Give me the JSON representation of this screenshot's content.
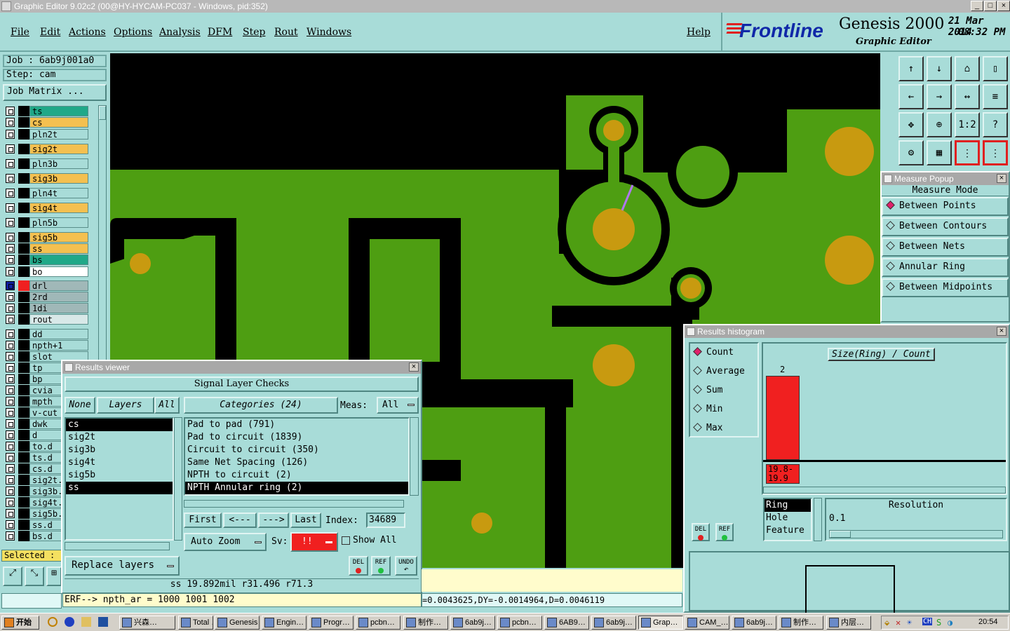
{
  "window": {
    "title": "Graphic Editor 9.02c2 (00@HY-HYCAM-PC037 - Windows, pid:352)"
  },
  "menu": {
    "items": [
      "File",
      "Edit",
      "Actions",
      "Options",
      "Analysis",
      "DFM",
      "Step",
      "Rout",
      "Windows"
    ],
    "help": "Help"
  },
  "brand": {
    "logo": "Frontline",
    "product": "Genesis 2000",
    "subtitle": "Graphic Editor",
    "date": "21 Mar 2014",
    "time": "08:32 PM"
  },
  "job": {
    "job_label": "Job  : 6ab9j001a0",
    "step_label": "Step: cam",
    "matrix_button": "Job Matrix ..."
  },
  "layers": [
    {
      "name": "ts",
      "color": "#20a888"
    },
    {
      "name": "cs",
      "color": "#f4c050"
    },
    {
      "name": "pln2t",
      "color": "#a8dcd8"
    },
    {
      "name": "sig2t",
      "color": "#f4c050"
    },
    {
      "name": "pln3b",
      "color": "#a8dcd8"
    },
    {
      "name": "sig3b",
      "color": "#f4c050"
    },
    {
      "name": "pln4t",
      "color": "#a8dcd8"
    },
    {
      "name": "sig4t",
      "color": "#f4c050"
    },
    {
      "name": "pln5b",
      "color": "#a8dcd8"
    },
    {
      "name": "sig5b",
      "color": "#f4c050"
    },
    {
      "name": "ss",
      "color": "#f4c050"
    },
    {
      "name": "bs",
      "color": "#20a888"
    },
    {
      "name": "bo",
      "color": "#ffffff"
    },
    {
      "name": "drl",
      "color": "#a0b8b8"
    },
    {
      "name": "2rd",
      "color": "#a0b8b8"
    },
    {
      "name": "1di",
      "color": "#a0b8b8"
    },
    {
      "name": "rout",
      "color": "#d8e8e8"
    },
    {
      "name": "dd",
      "color": "#a8dcd8"
    },
    {
      "name": "npth+1",
      "color": "#a8dcd8"
    },
    {
      "name": "slot",
      "color": "#a8dcd8"
    },
    {
      "name": "tp",
      "color": "#a8dcd8"
    },
    {
      "name": "bp",
      "color": "#a8dcd8"
    },
    {
      "name": "cvia",
      "color": "#a8dcd8"
    },
    {
      "name": "mpth",
      "color": "#a8dcd8"
    },
    {
      "name": "v-cut",
      "color": "#a8dcd8"
    },
    {
      "name": "dwk",
      "color": "#a8dcd8"
    },
    {
      "name": "d",
      "color": "#a8dcd8"
    },
    {
      "name": "to.d",
      "color": "#a8dcd8"
    },
    {
      "name": "ts.d",
      "color": "#a8dcd8"
    },
    {
      "name": "cs.d",
      "color": "#a8dcd8"
    },
    {
      "name": "sig2t.",
      "color": "#a8dcd8"
    },
    {
      "name": "sig3b.",
      "color": "#a8dcd8"
    },
    {
      "name": "sig4t.",
      "color": "#a8dcd8"
    },
    {
      "name": "sig5b.",
      "color": "#a8dcd8"
    },
    {
      "name": "ss.d",
      "color": "#a8dcd8"
    },
    {
      "name": "bs.d",
      "color": "#a8dcd8"
    }
  ],
  "selected_label": "Selected :",
  "results_viewer": {
    "title": "Results viewer",
    "header": "Signal Layer Checks",
    "none_btn": "None",
    "layers_btn": "Layers",
    "all_btn": "All",
    "categories_btn": "Categories (24)",
    "meas_label": "Meas:",
    "meas_value": "All",
    "layer_list": [
      "cs",
      "sig2t",
      "sig3b",
      "sig4t",
      "sig5b",
      "ss"
    ],
    "category_list": [
      "Pad to pad (791)",
      "Pad to circuit (1839)",
      "Circuit to circuit (350)",
      "Same Net Spacing (126)",
      "NPTH to circuit (2)",
      "NPTH Annular ring (2)"
    ],
    "first_btn": "First",
    "prev_btn": "<---",
    "next_btn": "--->",
    "last_btn": "Last",
    "index_label": "Index:",
    "index_value": "34689",
    "auto_zoom": "Auto Zoom",
    "sv_label": "Sv:",
    "sv_value": "!!",
    "show_all": "Show All",
    "replace_layers": "Replace layers",
    "del": "DEL",
    "ref": "REF",
    "undo": "UNDO",
    "status": "ss 19.892mil  r31.496  r71.3"
  },
  "erf_line": "ERF--> npth_ar = 1000 1001 1002",
  "coord_readout": "=0.0043625,DY=-0.0014964,D=0.0046119",
  "measure_popup": {
    "title": "Measure Popup",
    "mode_title": "Measure Mode",
    "options": [
      "Between Points",
      "Between Contours",
      "Between Nets",
      "Annular Ring",
      "Between Midpoints"
    ],
    "selected": 0
  },
  "histogram": {
    "title": "Results histogram",
    "options": [
      "Count",
      "Average",
      "Sum",
      "Min",
      "Max"
    ],
    "selected": 0,
    "axis_title": "Size(Ring) / Count",
    "bar_value": 2,
    "bar_label": "19.8-\n19.9",
    "types": [
      "Ring",
      "Hole",
      "Feature"
    ],
    "type_selected": 0,
    "resolution_label": "Resolution",
    "resolution_value": "0.1",
    "del": "DEL",
    "ref": "REF"
  },
  "tools": [
    "↑",
    "↓",
    "⌂",
    "▯",
    "←",
    "→",
    "↔",
    "≡",
    "✥",
    "⊕",
    "1:2",
    "?",
    "⚙",
    "▦",
    "⋮",
    "⋮"
  ],
  "taskbar": {
    "start": "开始",
    "tasks": [
      "兴森…",
      "Total …",
      "Genesis",
      "Engin…",
      "Progr…",
      "pcbn…",
      "制作…",
      "6ab9j…",
      "pcbn…",
      "6AB9…",
      "6ab9j…",
      "Grap…",
      "CAM_…",
      "6ab9j…",
      "制作…",
      "内层…"
    ],
    "clock": "20:54"
  },
  "colors": {
    "board_green": "#4e9e12",
    "pad_gold": "#c89a10",
    "teal": "#a8dcd8",
    "alert_red": "#f02020"
  }
}
